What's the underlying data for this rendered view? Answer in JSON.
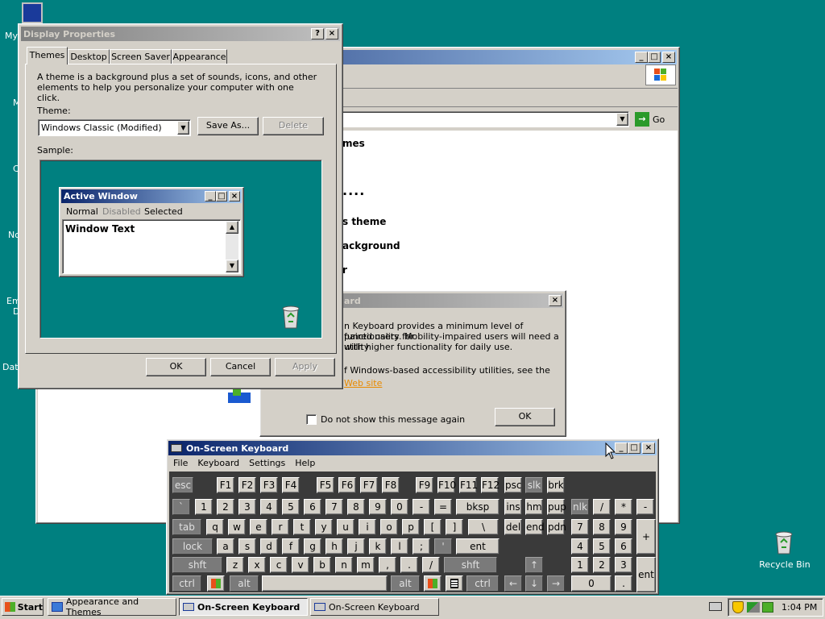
{
  "desktop": {
    "icons": [
      {
        "label": "My",
        "name": "my-computer-desktop-icon"
      },
      {
        "label": "M",
        "name": "my-documents-desktop-icon"
      },
      {
        "label": "C",
        "name": "control-desktop-icon"
      },
      {
        "label": "No",
        "name": "notepad-desktop-icon"
      },
      {
        "label": "Em",
        "name": "email-desktop-icon"
      },
      {
        "label": "D",
        "name": "d-desktop-icon"
      },
      {
        "label": "Data",
        "name": "data-desktop-icon"
      }
    ],
    "recycle_bin_label": "Recycle Bin"
  },
  "explorer": {
    "address_go": "Go",
    "items": [
      "mes",
      "....",
      "s theme",
      "ackground",
      "r"
    ]
  },
  "accessibility_dialog": {
    "title": "ard",
    "line1": "n Keyboard provides a minimum level of functionality for",
    "line2": "paired users. Mobility-impaired users will need a utility",
    "line3": "with higher functionality for daily use.",
    "line4": "f Windows-based accessibility utilities, see the",
    "link": "Web site",
    "checkbox_label": "Do not show this message again",
    "ok": "OK"
  },
  "display_properties": {
    "title": "Display Properties",
    "tabs": [
      "Themes",
      "Desktop",
      "Screen Saver",
      "Appearance"
    ],
    "description": "A theme is a background plus a set of sounds, icons, and other elements to help you personalize your computer with one click.",
    "theme_label": "Theme:",
    "theme_value": "Windows Classic (Modified)",
    "save_as": "Save As...",
    "delete": "Delete",
    "sample_label": "Sample:",
    "sample_window_title": "Active Window",
    "sample_menu": [
      "Normal",
      "Disabled",
      "Selected"
    ],
    "sample_text": "Window Text",
    "ok": "OK",
    "cancel": "Cancel",
    "apply": "Apply"
  },
  "osk": {
    "title": "On-Screen Keyboard",
    "menu": [
      "File",
      "Keyboard",
      "Settings",
      "Help"
    ],
    "keys": {
      "esc": "esc",
      "f1": "F1",
      "f2": "F2",
      "f3": "F3",
      "f4": "F4",
      "f5": "F5",
      "f6": "F6",
      "f7": "F7",
      "f8": "F8",
      "f9": "F9",
      "f10": "F10",
      "f11": "F11",
      "f12": "F12",
      "psc": "psc",
      "slk": "slk",
      "brk": "brk",
      "bq": "`",
      "n1": "1",
      "n2": "2",
      "n3": "3",
      "n4": "4",
      "n5": "5",
      "n6": "6",
      "n7": "7",
      "n8": "8",
      "n9": "9",
      "n0": "0",
      "minus": "-",
      "eq": "=",
      "bksp": "bksp",
      "ins": "ins",
      "hm": "hm",
      "pup": "pup",
      "nlk": "nlk",
      "kdiv": "/",
      "kmul": "*",
      "ksub": "-",
      "tab": "tab",
      "q": "q",
      "w": "w",
      "e": "e",
      "r": "r",
      "t": "t",
      "y": "y",
      "u": "u",
      "i": "i",
      "o": "o",
      "p": "p",
      "lbr": "[",
      "rbr": "]",
      "bsl": "\\",
      "del": "del",
      "end": "end",
      "pdn": "pdn",
      "k7": "7",
      "k8": "8",
      "k9": "9",
      "kadd": "+",
      "lock": "lock",
      "a": "a",
      "s": "s",
      "d": "d",
      "f": "f",
      "g": "g",
      "h": "h",
      "j": "j",
      "k": "k",
      "l": "l",
      "semi": ";",
      "quote": "'",
      "ent": "ent",
      "k4": "4",
      "k5": "5",
      "k6": "6",
      "shft": "shft",
      "z": "z",
      "x": "x",
      "c": "c",
      "v": "v",
      "b": "b",
      "n": "n",
      "m": "m",
      "comma": ",",
      "dot": ".",
      "slash": "/",
      "shft2": "shft",
      "up": "↑",
      "k1": "1",
      "k2": "2",
      "k3": "3",
      "kent": "ent",
      "ctrl": "ctrl",
      "alt": "alt",
      "alt2": "alt",
      "ctrl2": "ctrl",
      "left": "←",
      "down": "↓",
      "right": "→",
      "k0": "0",
      "kdot": "."
    }
  },
  "taskbar": {
    "start": "Start",
    "tasks": [
      "Appearance and Themes",
      "On-Screen Keyboard",
      "On-Screen Keyboard"
    ],
    "clock": "1:04 PM"
  }
}
